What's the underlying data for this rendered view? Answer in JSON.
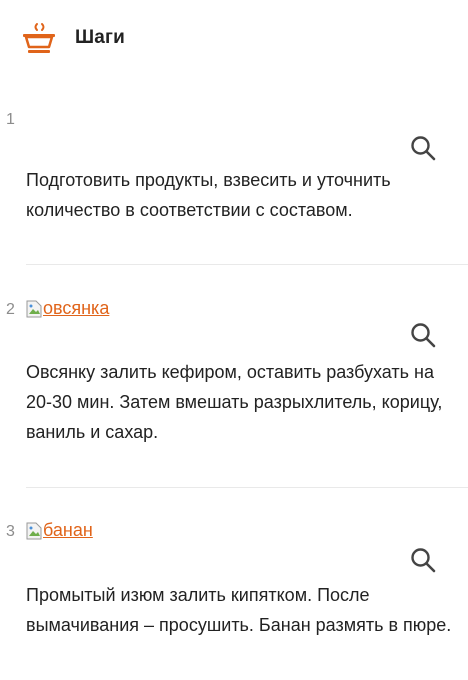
{
  "header": {
    "title": "Шаги",
    "icon": "cooking-pot-icon",
    "accent_color": "#e0641a"
  },
  "steps": [
    {
      "number": "1",
      "image_alt": "",
      "text": "Подготовить продукты, взвесить и уточнить количество в соответствии с составом."
    },
    {
      "number": "2",
      "image_alt": "овсянка",
      "text": "Овсянку залить кефиром, оставить разбухать на 20-30 мин. Затем вмешать разрыхлитель, корицу, ваниль и сахар."
    },
    {
      "number": "3",
      "image_alt": "банан",
      "text": "Промытый изюм залить кипятком. После вымачивания – просушить. Банан размять в пюре."
    }
  ]
}
